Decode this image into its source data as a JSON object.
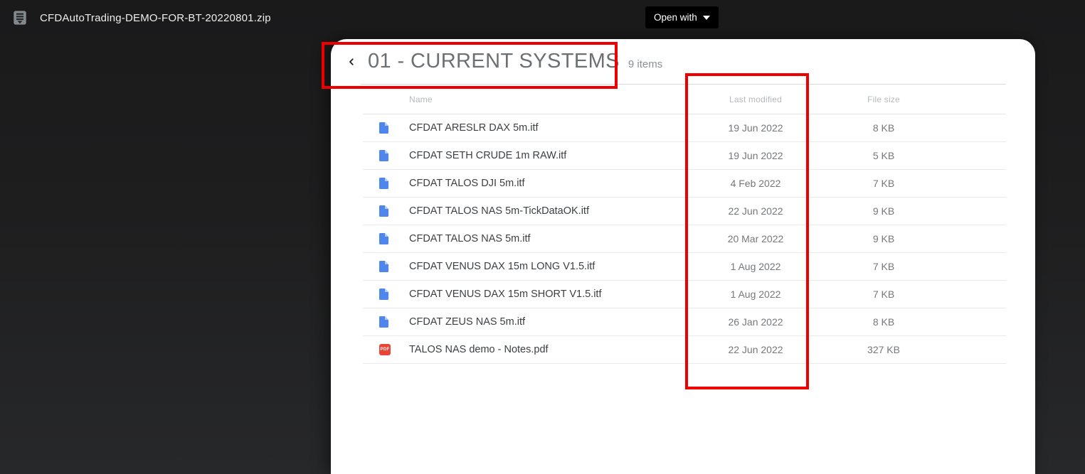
{
  "topbar": {
    "filename": "CFDAutoTrading-DEMO-FOR-BT-20220801.zip",
    "open_with_label": "Open with"
  },
  "viewer": {
    "folder_title": "01 - CURRENT SYSTEMS",
    "items_count": "9 items",
    "table": {
      "columns": {
        "name": "Name",
        "modified": "Last modified",
        "size": "File size"
      },
      "files": [
        {
          "type": "itf",
          "name": "CFDAT ARESLR DAX 5m.itf",
          "modified": "19 Jun 2022",
          "size": "8 KB"
        },
        {
          "type": "itf",
          "name": "CFDAT SETH CRUDE 1m RAW.itf",
          "modified": "19 Jun 2022",
          "size": "5 KB"
        },
        {
          "type": "itf",
          "name": "CFDAT TALOS DJI 5m.itf",
          "modified": "4 Feb 2022",
          "size": "7 KB"
        },
        {
          "type": "itf",
          "name": "CFDAT TALOS NAS 5m-TickDataOK.itf",
          "modified": "22 Jun 2022",
          "size": "9 KB"
        },
        {
          "type": "itf",
          "name": "CFDAT TALOS NAS 5m.itf",
          "modified": "20 Mar 2022",
          "size": "9 KB"
        },
        {
          "type": "itf",
          "name": "CFDAT VENUS DAX 15m LONG V1.5.itf",
          "modified": "1 Aug 2022",
          "size": "7 KB"
        },
        {
          "type": "itf",
          "name": "CFDAT VENUS DAX 15m SHORT V1.5.itf",
          "modified": "1 Aug 2022",
          "size": "7 KB"
        },
        {
          "type": "itf",
          "name": "CFDAT ZEUS NAS 5m.itf",
          "modified": "26 Jan 2022",
          "size": "8 KB"
        },
        {
          "type": "pdf",
          "name": "TALOS NAS demo - Notes.pdf",
          "modified": "22 Jun 2022",
          "size": "327 KB",
          "badge": "PDF"
        }
      ]
    }
  },
  "colors": {
    "doc_icon_blue": "#4f86ec",
    "doc_icon_fold": "#aecbfa",
    "pdf_icon_red": "#e94436",
    "annotation_red": "#ee0000",
    "card_background": "#ffffff",
    "page_background_dark": "#1a1a1b"
  }
}
